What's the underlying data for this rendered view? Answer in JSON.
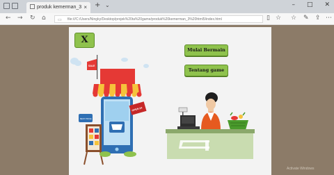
{
  "browser": {
    "tab_title": "produk kemerman_3",
    "new_tab": "+",
    "url": "file:///C:/Users/Ningky/Desktop/projek%20ta%20game/produk%20kemerman_3%20html5/index.html"
  },
  "game": {
    "close_label": "X",
    "start_label": "Mulai Bermain",
    "about_label": "Tentang game",
    "sign_sale": "SALE",
    "sign_open": "OPEN 24",
    "sign_best": "BEST PRICE"
  },
  "colors": {
    "button_green": "#8fc24d",
    "frame_brown": "#8c7b68",
    "stage_bg": "#f3f3f3",
    "awning_red": "#e53935",
    "counter_green": "#c9dcb0"
  },
  "watermark": "Activate Windows"
}
